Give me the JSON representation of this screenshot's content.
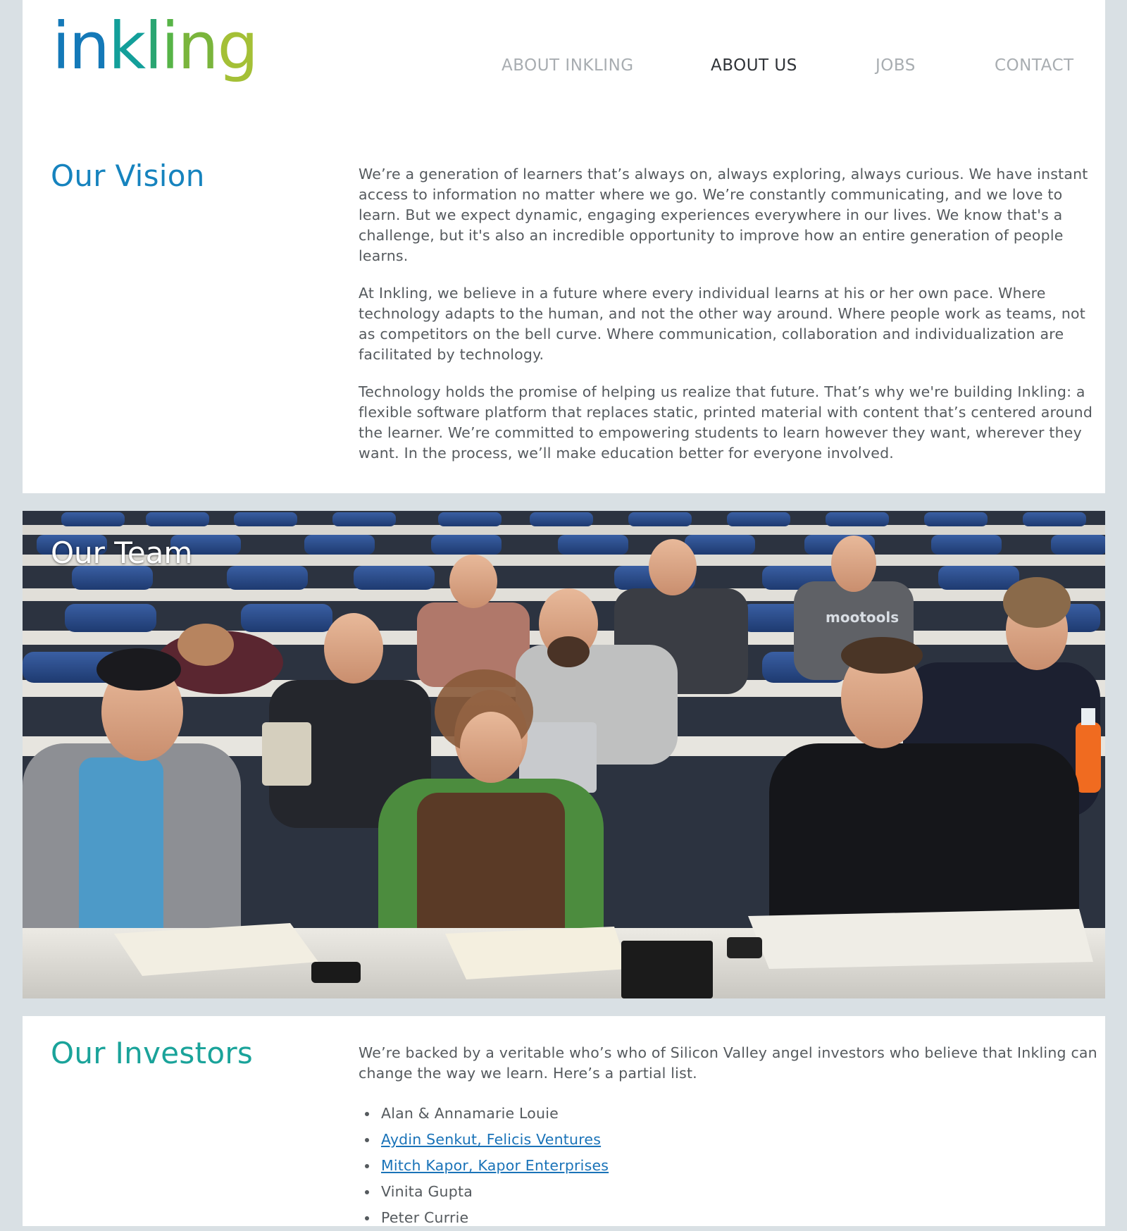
{
  "brand": {
    "logo_letters": [
      "i",
      "n",
      "k",
      "l",
      "i",
      "n",
      "g"
    ],
    "logo_colors": [
      "#1479b8",
      "#1479b8",
      "#139f9a",
      "#2aa572",
      "#57b447",
      "#7ab53c",
      "#a4c036"
    ]
  },
  "nav": {
    "items": [
      {
        "label": "ABOUT INKLING"
      },
      {
        "label": "ABOUT US"
      },
      {
        "label": "JOBS"
      },
      {
        "label": "CONTACT"
      }
    ]
  },
  "vision": {
    "title": "Our Vision",
    "title_color": "#1683be",
    "paragraphs": [
      "We’re a generation of learners that’s always on, always exploring, always curious. We have instant access to information no matter where we go. We’re constantly communicating, and we love to learn. But we expect dynamic, engaging experiences everywhere in our lives. We know that's a challenge, but it's also an incredible opportunity to improve how an entire generation of people learns.",
      "At Inkling, we believe in a future where every individual learns at his or her own pace. Where technology adapts to the human, and not the other way around. Where people work as teams, not as competitors on the bell curve. Where communication, collaboration and individualization are facilitated by technology.",
      "Technology holds the promise of helping us realize that future. That’s why we're building Inkling: a flexible software platform that replaces static, printed material with content that’s centered around the learner. We’re committed to empowering students to learn however they want, wherever they want. In the process, we’ll make education better for everyone involved."
    ]
  },
  "team": {
    "title": "Our Team",
    "shirt_text": "mootools"
  },
  "investors": {
    "title": "Our Investors",
    "title_color": "#1aa39a",
    "intro": "We’re backed by a veritable who’s who of Silicon Valley angel investors who believe that Inkling can change the way we learn. Here’s a partial list.",
    "list": [
      {
        "name": "Alan & Annamarie Louie",
        "link": false
      },
      {
        "name": "Aydin Senkut, Felicis Ventures",
        "link": true
      },
      {
        "name": "Mitch Kapor, Kapor Enterprises",
        "link": true
      },
      {
        "name": "Vinita Gupta",
        "link": false
      },
      {
        "name": "Peter Currie",
        "link": false
      }
    ]
  }
}
